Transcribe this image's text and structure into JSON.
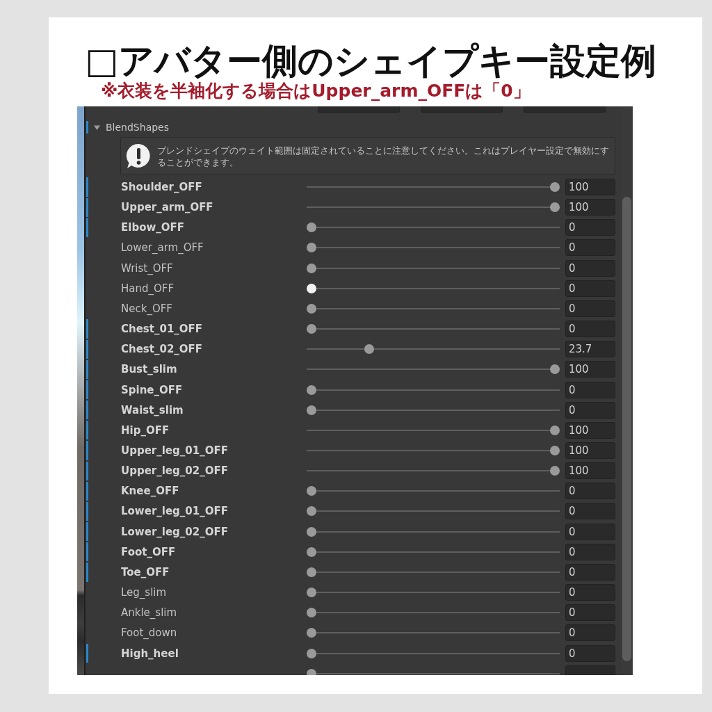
{
  "title": "□アバター側のシェイプキー設定例",
  "note": "※衣装を半袖化する場合はUpper_arm_OFFは「0」",
  "inspector": {
    "section": {
      "label": "BlendShapes",
      "expanded": true,
      "overridden": true
    },
    "help": {
      "text": "ブレンドシェイプのウェイト範囲は固定されていることに注意してください。これはプレイヤー設定で無効にすることができます。"
    },
    "blend_shapes": [
      {
        "name": "Shoulder_OFF",
        "value": "100",
        "level": 1,
        "overridden": true,
        "hovered": false
      },
      {
        "name": "Upper_arm_OFF",
        "value": "100",
        "level": 1,
        "overridden": true,
        "hovered": false
      },
      {
        "name": "Elbow_OFF",
        "value": "0",
        "level": 0,
        "overridden": true,
        "hovered": false
      },
      {
        "name": "Lower_arm_OFF",
        "value": "0",
        "level": 0,
        "overridden": false,
        "hovered": false
      },
      {
        "name": "Wrist_OFF",
        "value": "0",
        "level": 0,
        "overridden": false,
        "hovered": false
      },
      {
        "name": "Hand_OFF",
        "value": "0",
        "level": 0,
        "overridden": false,
        "hovered": true
      },
      {
        "name": "Neck_OFF",
        "value": "0",
        "level": 0,
        "overridden": false,
        "hovered": false
      },
      {
        "name": "Chest_01_OFF",
        "value": "0",
        "level": 0,
        "overridden": true,
        "hovered": false
      },
      {
        "name": "Chest_02_OFF",
        "value": "23.7",
        "level": 0.237,
        "overridden": true,
        "hovered": false
      },
      {
        "name": "Bust_slim",
        "value": "100",
        "level": 1,
        "overridden": true,
        "hovered": false
      },
      {
        "name": "Spine_OFF",
        "value": "0",
        "level": 0,
        "overridden": true,
        "hovered": false
      },
      {
        "name": "Waist_slim",
        "value": "0",
        "level": 0,
        "overridden": true,
        "hovered": false
      },
      {
        "name": "Hip_OFF",
        "value": "100",
        "level": 1,
        "overridden": true,
        "hovered": false
      },
      {
        "name": "Upper_leg_01_OFF",
        "value": "100",
        "level": 1,
        "overridden": true,
        "hovered": false
      },
      {
        "name": "Upper_leg_02_OFF",
        "value": "100",
        "level": 1,
        "overridden": true,
        "hovered": false
      },
      {
        "name": "Knee_OFF",
        "value": "0",
        "level": 0,
        "overridden": true,
        "hovered": false
      },
      {
        "name": "Lower_leg_01_OFF",
        "value": "0",
        "level": 0,
        "overridden": true,
        "hovered": false
      },
      {
        "name": "Lower_leg_02_OFF",
        "value": "0",
        "level": 0,
        "overridden": true,
        "hovered": false
      },
      {
        "name": "Foot_OFF",
        "value": "0",
        "level": 0,
        "overridden": true,
        "hovered": false
      },
      {
        "name": "Toe_OFF",
        "value": "0",
        "level": 0,
        "overridden": true,
        "hovered": false
      },
      {
        "name": "Leg_slim",
        "value": "0",
        "level": 0,
        "overridden": false,
        "hovered": false
      },
      {
        "name": "Ankle_slim",
        "value": "0",
        "level": 0,
        "overridden": false,
        "hovered": false
      },
      {
        "name": "Foot_down",
        "value": "0",
        "level": 0,
        "overridden": false,
        "hovered": false
      },
      {
        "name": "High_heel",
        "value": "0",
        "level": 0,
        "overridden": true,
        "hovered": false
      },
      {
        "level": 0,
        "hovered": false
      }
    ]
  }
}
